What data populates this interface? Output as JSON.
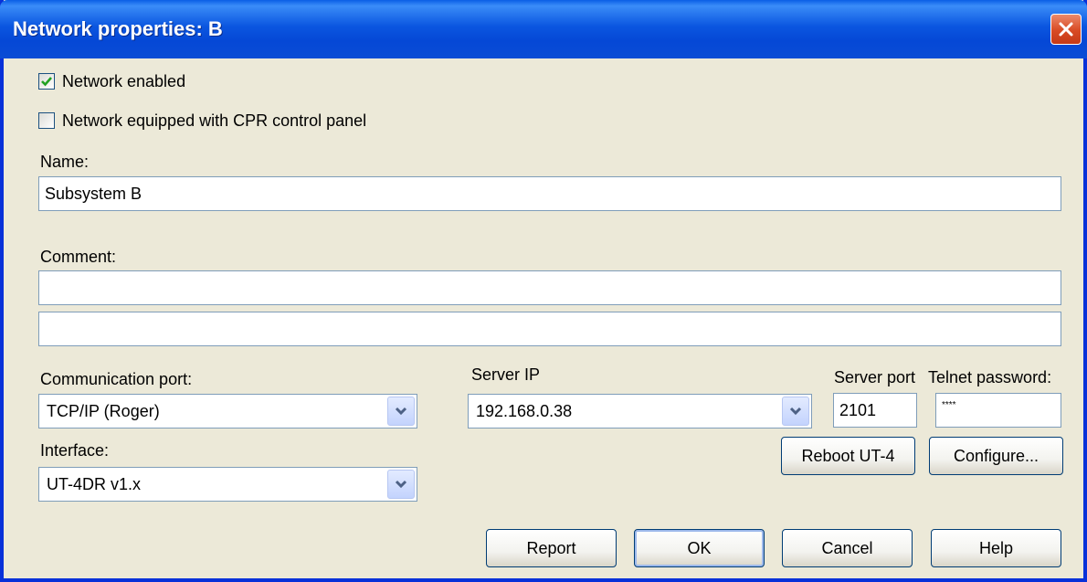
{
  "window": {
    "title": "Network properties: B",
    "close_icon": "close-icon"
  },
  "options": {
    "network_enabled": {
      "label": "Network enabled",
      "checked": true
    },
    "cpr_panel": {
      "label": "Network equipped with CPR control panel",
      "checked": false
    }
  },
  "name": {
    "label": "Name:",
    "value": "Subsystem B"
  },
  "comment": {
    "label": "Comment:",
    "line1": "",
    "line2": ""
  },
  "communication_port": {
    "label": "Communication port:",
    "value": "TCP/IP (Roger)"
  },
  "server_ip": {
    "label": "Server IP",
    "value": "192.168.0.38"
  },
  "server_port": {
    "label": "Server port",
    "value": "2101"
  },
  "telnet_password": {
    "label": "Telnet password:",
    "value": "****"
  },
  "interface": {
    "label": "Interface:",
    "value": "UT-4DR v1.x"
  },
  "buttons": {
    "reboot": "Reboot UT-4",
    "configure": "Configure...",
    "report": "Report",
    "ok": "OK",
    "cancel": "Cancel",
    "help": "Help"
  },
  "colors": {
    "titlebar": "#0b56e0",
    "dialog_bg": "#ece9d8",
    "close_button": "#d84a24"
  }
}
